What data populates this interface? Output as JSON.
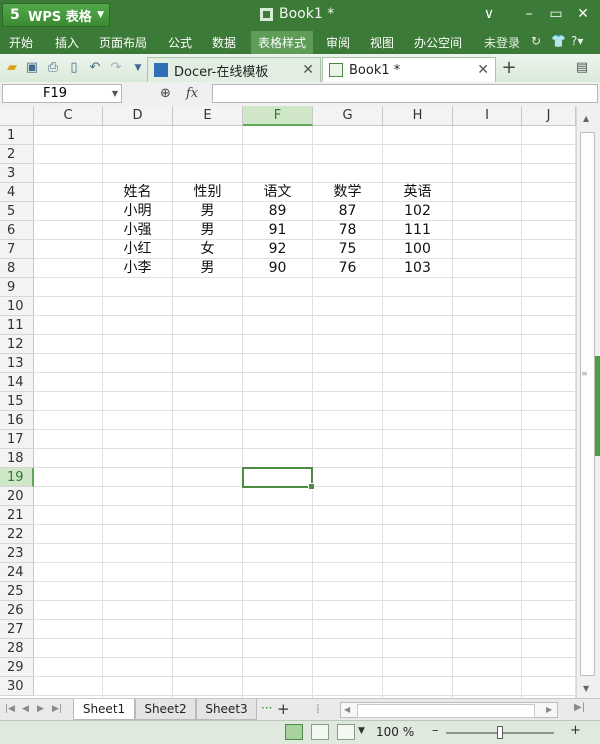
{
  "app": {
    "name": "WPS 表格",
    "doc_title": "Book1 *"
  },
  "menu": {
    "items": [
      "开始",
      "插入",
      "页面布局",
      "公式",
      "数据",
      "表格样式",
      "审阅",
      "视图",
      "办公空间"
    ],
    "active": "表格样式",
    "login": "未登录"
  },
  "tabs": [
    {
      "label": "Docer-在线模板",
      "active": false
    },
    {
      "label": "Book1 *",
      "active": true
    }
  ],
  "formula_bar": {
    "cell_ref": "F19",
    "fx": "fx",
    "value": ""
  },
  "grid": {
    "columns": [
      "C",
      "D",
      "E",
      "F",
      "G",
      "H",
      "I",
      "J"
    ],
    "active_column": "F",
    "rows": [
      "1",
      "2",
      "3",
      "4",
      "5",
      "6",
      "7",
      "8",
      "9",
      "10",
      "11",
      "12",
      "13",
      "14",
      "15",
      "16",
      "17",
      "18",
      "19",
      "20",
      "21",
      "22",
      "23",
      "24",
      "25",
      "26",
      "27",
      "28",
      "29",
      "30"
    ],
    "active_row": "19",
    "table": {
      "headers": [
        "姓名",
        "性别",
        "语文",
        "数学",
        "英语"
      ],
      "rows": [
        [
          "小明",
          "男",
          "89",
          "87",
          "102"
        ],
        [
          "小强",
          "男",
          "91",
          "78",
          "111"
        ],
        [
          "小红",
          "女",
          "92",
          "75",
          "100"
        ],
        [
          "小李",
          "男",
          "90",
          "76",
          "103"
        ]
      ]
    }
  },
  "sheets": {
    "tabs": [
      "Sheet1",
      "Sheet2",
      "Sheet3"
    ],
    "active": "Sheet1",
    "more": "···",
    "add": "+"
  },
  "status": {
    "zoom": "100 %",
    "zoom_fraction": 0.5
  },
  "colors": {
    "brand": "#3c7a37",
    "active_header": "#cfe6c8",
    "selection": "#4f8c43"
  }
}
